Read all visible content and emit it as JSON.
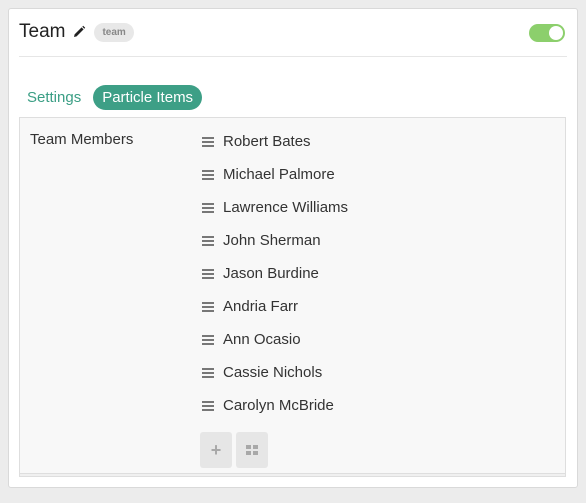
{
  "header": {
    "title": "Team",
    "badge": "team",
    "enabled": true,
    "edit_icon": "pencil-icon"
  },
  "tabs": [
    {
      "label": "Settings",
      "active": false
    },
    {
      "label": "Particle Items",
      "active": true
    }
  ],
  "field": {
    "label": "Team Members",
    "items": [
      "Robert Bates",
      "Michael Palmore",
      "Lawrence Williams",
      "John Sherman",
      "Jason Burdine",
      "Andria Farr",
      "Ann Ocasio",
      "Cassie Nichols",
      "Carolyn McBride"
    ],
    "add_label": "+",
    "add_icon": "plus-icon",
    "grid_icon": "grid-icon"
  },
  "colors": {
    "accent": "#3d9f86",
    "toggle_on": "#8ccf6c"
  }
}
